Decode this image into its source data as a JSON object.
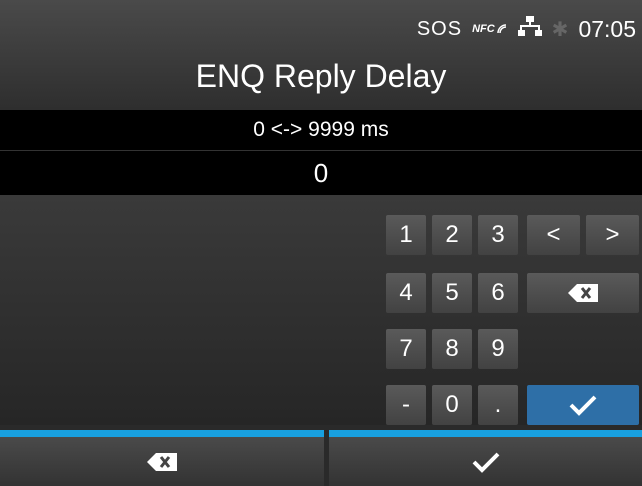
{
  "status": {
    "sos": "SOS",
    "nfc": "NFC",
    "time": "07:05",
    "icons": [
      "nfc-icon",
      "network-icon",
      "bluetooth-icon"
    ]
  },
  "title": "ENQ Reply Delay",
  "range": "0 <-> 9999 ms",
  "value": "0",
  "keypad": {
    "digits": [
      "1",
      "2",
      "3",
      "4",
      "5",
      "6",
      "7",
      "8",
      "9",
      "-",
      "0",
      "."
    ],
    "left": "<",
    "right": ">",
    "backspace_icon": "backspace-icon",
    "enter_icon": "checkmark-icon"
  },
  "bottom": {
    "left_icon": "backspace-icon",
    "right_icon": "checkmark-icon"
  },
  "colors": {
    "accent": "#18a0e0",
    "enter": "#2e6fa7"
  }
}
